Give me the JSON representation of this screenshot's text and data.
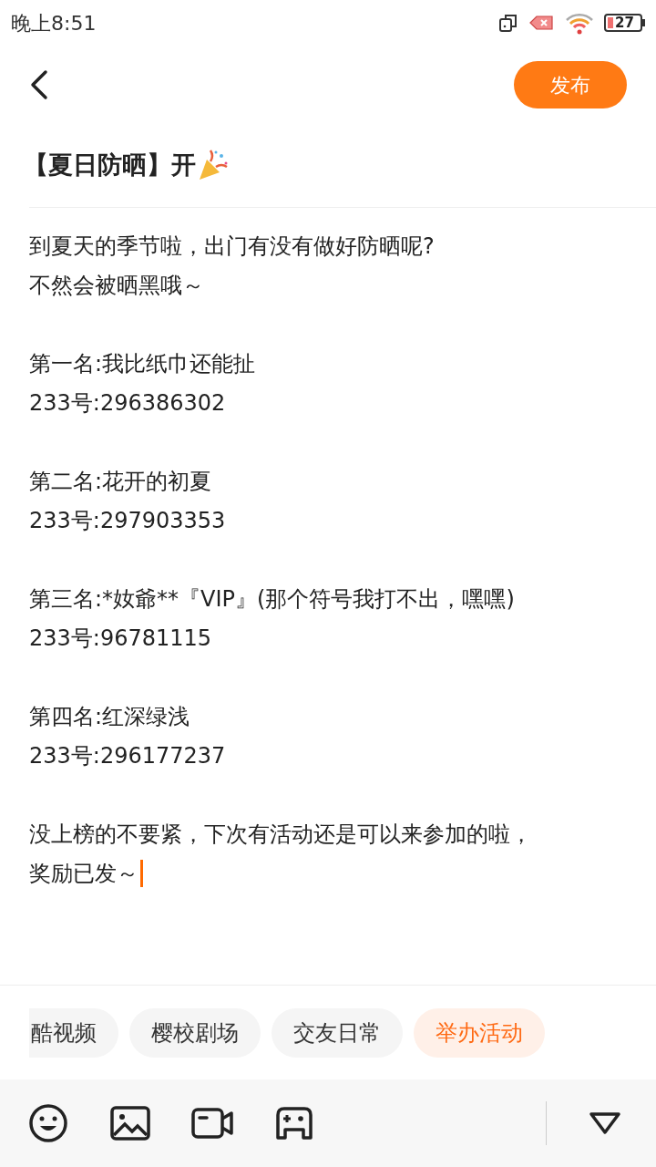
{
  "status_bar": {
    "time": "晚上8:51",
    "battery": "27"
  },
  "header": {
    "publish": "发布"
  },
  "title": "【夏日防晒】开",
  "body": [
    [
      "到夏天的季节啦，出门有没有做好防晒呢?",
      "不然会被晒黑哦～"
    ],
    [
      "第一名:我比纸巾还能扯",
      "233号:296386302"
    ],
    [
      "第二名:花开的初夏",
      "233号:297903353"
    ],
    [
      "第三名:*奻爺**『VIP』(那个符号我打不出，嘿嘿)",
      "233号:96781115"
    ],
    [
      "第四名:红深绿浅",
      "233号:296177237"
    ],
    [
      "没上榜的不要紧，下次有活动还是可以来参加的啦，",
      "奖励已发～"
    ]
  ],
  "topics": [
    {
      "label": "酷视频",
      "selected": false
    },
    {
      "label": "樱校剧场",
      "selected": false
    },
    {
      "label": "交友日常",
      "selected": false
    },
    {
      "label": "举办活动",
      "selected": true
    }
  ]
}
